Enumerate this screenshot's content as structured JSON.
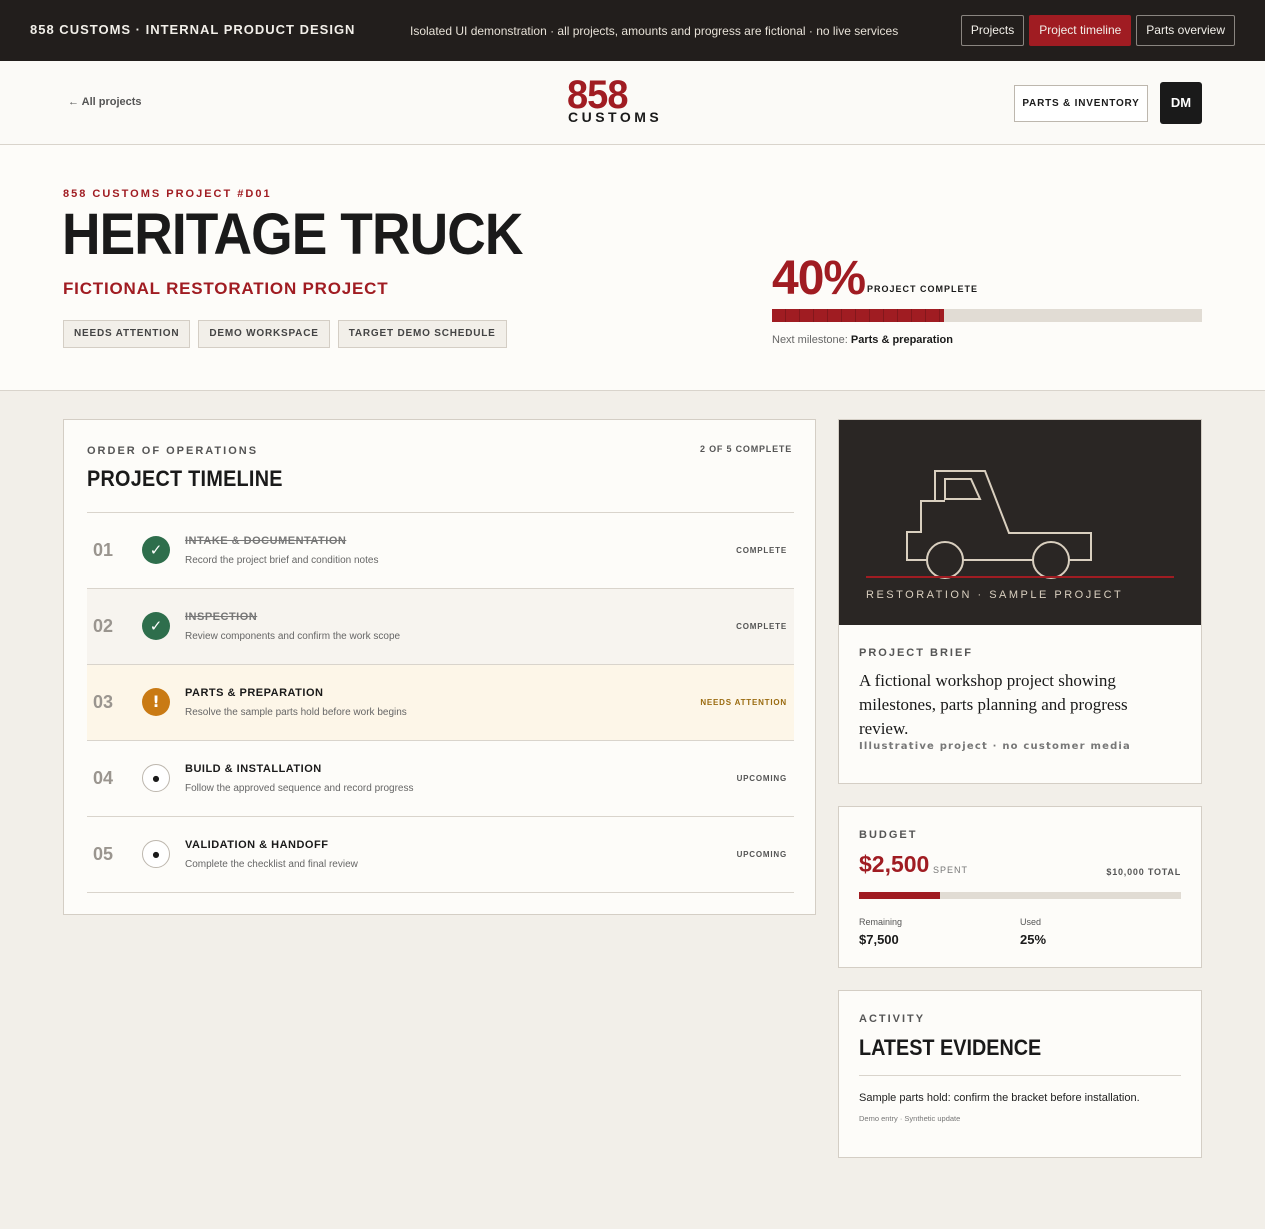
{
  "topbar": {
    "brand": "858 CUSTOMS · INTERNAL PRODUCT DESIGN",
    "note": "Isolated UI demonstration · all projects, amounts and progress are fictional · no live services",
    "nav": [
      "Projects",
      "Project timeline",
      "Parts overview"
    ],
    "active_nav": "Project timeline",
    "accent_color": "#a01c22"
  },
  "header": {
    "back_label": "← All projects",
    "logo_number": "858",
    "logo_word": "CUSTOMS",
    "parts_button": "PARTS & INVENTORY",
    "avatar_initials": "DM"
  },
  "hero": {
    "kicker": "858 CUSTOMS PROJECT #D01",
    "title": "HERITAGE TRUCK",
    "subtitle": "FICTIONAL RESTORATION PROJECT",
    "tags": [
      "NEEDS ATTENTION",
      "DEMO WORKSPACE",
      "TARGET DEMO SCHEDULE"
    ],
    "progress_value": "40%",
    "progress_fraction": 0.4,
    "progress_label": "PROJECT COMPLETE",
    "next_label": "Next milestone:",
    "next_value": "Parts & preparation"
  },
  "timeline": {
    "kicker": "ORDER OF OPERATIONS",
    "heading": "PROJECT TIMELINE",
    "count": "2 OF 5 COMPLETE",
    "steps": [
      {
        "num": "01",
        "title": "INTAKE & DOCUMENTATION",
        "desc": "Record the project brief and condition notes",
        "status": "COMPLETE",
        "state": "done",
        "icon": "✓"
      },
      {
        "num": "02",
        "title": "INSPECTION",
        "desc": "Review components and confirm the work scope",
        "status": "COMPLETE",
        "state": "done",
        "icon": "✓"
      },
      {
        "num": "03",
        "title": "PARTS & PREPARATION",
        "desc": "Resolve the sample parts hold before work begins",
        "status": "NEEDS ATTENTION",
        "state": "attention",
        "icon": "!"
      },
      {
        "num": "04",
        "title": "BUILD & INSTALLATION",
        "desc": "Follow the approved sequence and record progress",
        "status": "UPCOMING",
        "state": "upcoming",
        "icon": "●"
      },
      {
        "num": "05",
        "title": "VALIDATION & HANDOFF",
        "desc": "Complete the checklist and final review",
        "status": "UPCOMING",
        "state": "upcoming",
        "icon": "●"
      }
    ]
  },
  "brief": {
    "caption": "RESTORATION · SAMPLE PROJECT",
    "kicker": "PROJECT BRIEF",
    "text": "A fictional workshop project showing milestones, parts planning and progress review.",
    "fine": "Illustrative project · no customer media"
  },
  "budget": {
    "kicker": "BUDGET",
    "spent": "$2,500",
    "spent_label": "SPENT",
    "total": "$10,000 TOTAL",
    "used_fraction": 0.25,
    "remaining_label": "Remaining",
    "remaining_value": "$7,500",
    "used_label": "Used",
    "used_value": "25%"
  },
  "activity": {
    "kicker": "ACTIVITY",
    "heading": "LATEST EVIDENCE",
    "entry": "Sample parts hold: confirm the bracket before installation.",
    "meta": "Demo entry · Synthetic update"
  }
}
